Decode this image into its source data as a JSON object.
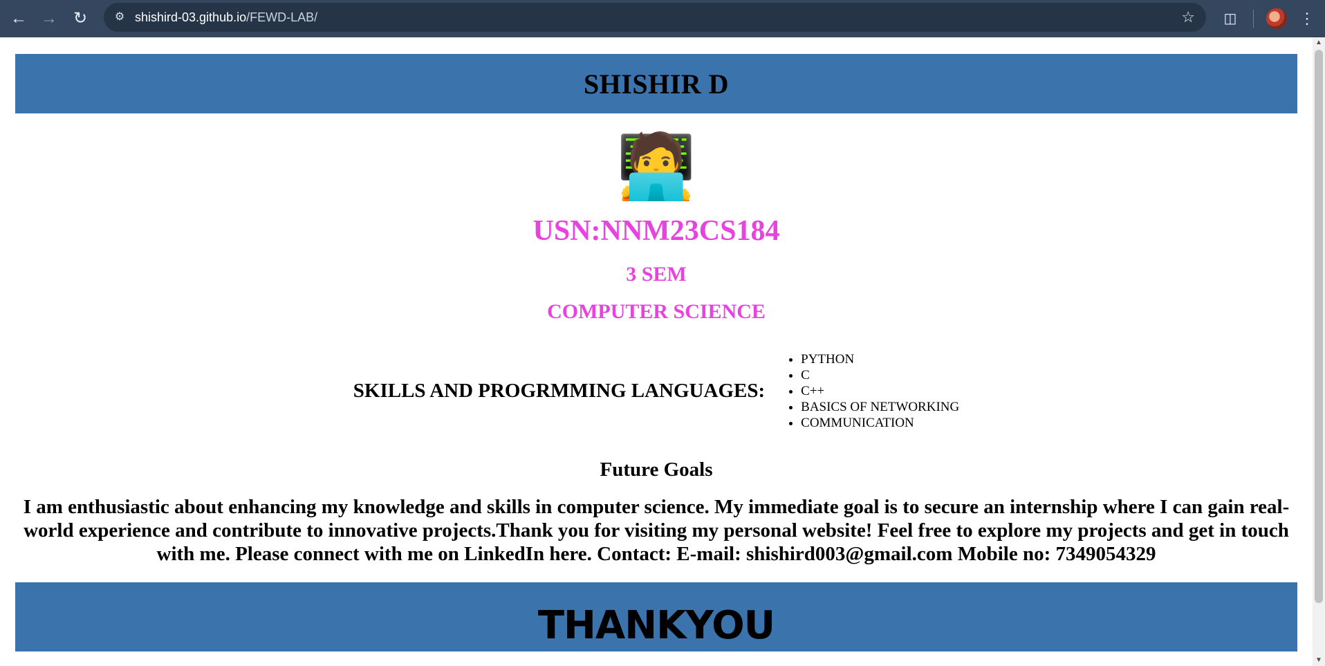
{
  "browser": {
    "url_host": "shishird-03.github.io",
    "url_path": "/FEWD-LAB/",
    "back_icon": "back-arrow-icon",
    "forward_icon": "forward-arrow-icon",
    "reload_icon": "reload-icon"
  },
  "page": {
    "name": "SHISHIR D",
    "avatar_emoji": "🧑‍💻",
    "usn": "USN:NNM23CS184",
    "semester": "3 SEM",
    "department": "COMPUTER SCIENCE",
    "skills_heading": "SKILLS AND PROGRMMING LANGUAGES:",
    "skills": [
      "PYTHON",
      "C",
      "C++",
      "BASICS OF NETWORKING",
      "COMMUNICATION"
    ],
    "goals_title": "Future Goals",
    "goals_text": "I am enthusiastic about enhancing my knowledge and skills in computer science. My immediate goal is to secure an internship where I can gain real-world experience and contribute to innovative projects.Thank you for visiting my personal website! Feel free to explore my projects and get in touch with me. Please connect with me on LinkedIn here. Contact: E-mail: shishird003@gmail.com Mobile no: 7349054329",
    "footer_text": "THANKYOU"
  },
  "colors": {
    "header_bar": "#3b73ad",
    "accent_pink": "#e843e0",
    "browser_toolbar": "#35475f"
  }
}
